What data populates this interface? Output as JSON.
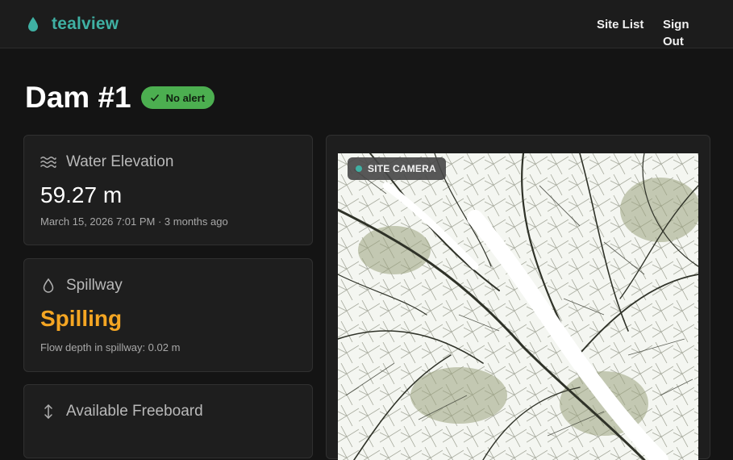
{
  "app": {
    "name": "tealview",
    "accent": "#3fb0a3"
  },
  "nav": {
    "site_list": "Site List",
    "sign_out": "Sign Out"
  },
  "page": {
    "title": "Dam #1",
    "alert_badge": {
      "label": "No alert",
      "color": "#4caf50",
      "icon": "check-icon"
    }
  },
  "cards": {
    "water_elevation": {
      "icon": "waves-icon",
      "label": "Water Elevation",
      "value": "59.27 m",
      "sub": "March 15, 2026 7:01 PM · 3 months ago"
    },
    "spillway": {
      "icon": "droplet-icon",
      "label": "Spillway",
      "value": "Spilling",
      "value_color": "#f5a623",
      "sub": "Flow depth in spillway: 0.02 m"
    },
    "freeboard": {
      "icon": "vertical-arrows-icon",
      "label": "Available Freeboard"
    }
  },
  "camera": {
    "label": "SITE CAMERA",
    "dot_color": "#3fb0a3"
  }
}
